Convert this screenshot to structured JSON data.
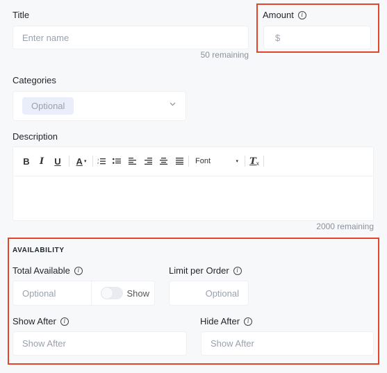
{
  "title_field": {
    "label": "Title",
    "placeholder": "Enter name",
    "remaining": "50 remaining"
  },
  "amount_field": {
    "label": "Amount",
    "info_icon": "info-icon",
    "prefix": "$"
  },
  "categories_field": {
    "label": "Categories",
    "selected_tag": "Optional",
    "dropdown_icon": "chevron-down-icon"
  },
  "description_field": {
    "label": "Description",
    "toolbar": {
      "bold": "B",
      "italic": "I",
      "underline": "U",
      "font_color": "A",
      "font_select": "Font",
      "clear_format": "T"
    },
    "remaining": "2000 remaining"
  },
  "availability": {
    "section_title": "AVAILABILITY",
    "total_available": {
      "label": "Total Available",
      "placeholder": "Optional",
      "toggle_label": "Show",
      "toggle_on": false
    },
    "limit_per_order": {
      "label": "Limit per Order",
      "placeholder": "Optional"
    },
    "show_after": {
      "label": "Show After",
      "placeholder": "Show After"
    },
    "hide_after": {
      "label": "Hide After",
      "placeholder": "Show After"
    }
  },
  "colors": {
    "highlight_border": "#e2452b",
    "background": "#f7f8fa",
    "tag_background": "#eaeefb"
  }
}
